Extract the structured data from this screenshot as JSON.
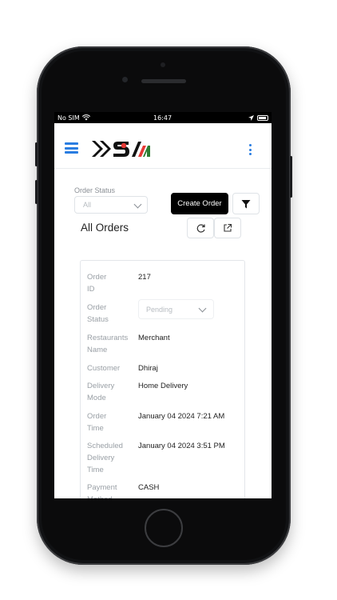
{
  "statusbar": {
    "carrier": "No SIM",
    "time": "16:47"
  },
  "brand": {
    "accent": "#2a7de1",
    "logo_red": "#e53935",
    "logo_green": "#2e7d32"
  },
  "filters": {
    "order_status_label": "Order Status",
    "order_status_value": "All",
    "create_order_label": "Create Order"
  },
  "orders": {
    "title": "All Orders"
  },
  "order": [
    {
      "key": "Order\nID",
      "value": "217"
    },
    {
      "key": "Order\nStatus",
      "value": "Pending"
    },
    {
      "key": "Restaurants\nName",
      "value": "Merchant"
    },
    {
      "key": "Customer",
      "value": "Dhiraj"
    },
    {
      "key": "Delivery\nMode",
      "value": "Home Delivery"
    },
    {
      "key": "Order\nTime",
      "value": "January 04 2024 7:21 AM"
    },
    {
      "key": "Scheduled\nDelivery\nTime",
      "value": "January 04 2024 3:51 PM"
    },
    {
      "key": "Payment\nMethod",
      "value": "CASH"
    }
  ],
  "icons": [
    "wifi-icon",
    "location-arrow-icon",
    "battery-icon",
    "hamburger-icon",
    "kebab-menu-icon",
    "chevron-down-icon",
    "filter-icon",
    "refresh-icon",
    "external-link-icon"
  ]
}
